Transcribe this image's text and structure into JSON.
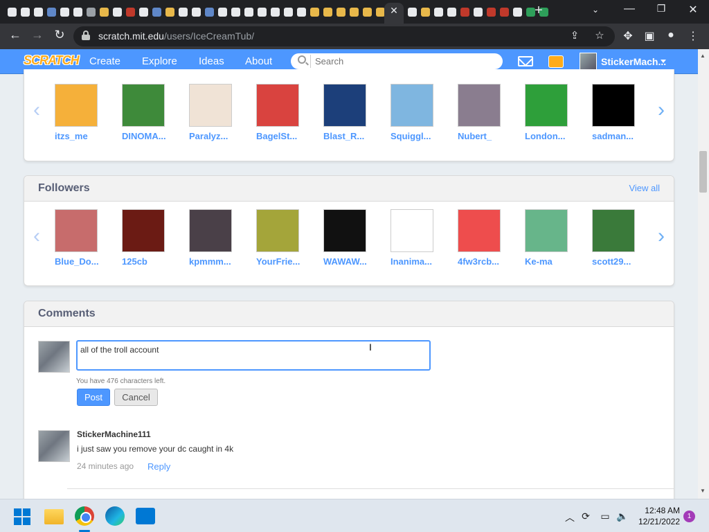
{
  "browser": {
    "url_host": "scratch.mit.edu",
    "url_path": "/users/IceCreamTub/",
    "tab_close": "✕",
    "new_tab": "+",
    "tab_icon_colors": [
      "#e8eaed",
      "#e8eaed",
      "#e8eaed",
      "#5f87c8",
      "#e8eaed",
      "#e8eaed",
      "#9aa0a6",
      "#e8b84a",
      "#e8eaed",
      "#c0392b",
      "#e8eaed",
      "#5f87c8",
      "#e8b84a",
      "#e8eaed",
      "#e8eaed",
      "#5f87c8",
      "#e8eaed",
      "#e8eaed",
      "#e8eaed",
      "#e8eaed",
      "#e8eaed",
      "#e8eaed",
      "#e8eaed",
      "#e8b84a",
      "#e8b84a",
      "#e8b84a",
      "#e8b84a",
      "#e8b84a",
      "#e8b84a",
      "#e8b84a"
    ],
    "tab_icon_colors_2": [
      "#e8eaed",
      "#e8b84a",
      "#e8eaed",
      "#e8eaed",
      "#c0392b",
      "#e8eaed",
      "#c0392b",
      "#c0392b",
      "#e8eaed",
      "#2e9f5a",
      "#2e9f5a"
    ]
  },
  "scratch_nav": {
    "logo": "SCRATCH",
    "links": [
      "Create",
      "Explore",
      "Ideas",
      "About"
    ],
    "search_placeholder": "Search",
    "username": "StickerMach...",
    "brand_color": "#4d97ff"
  },
  "following": {
    "users": [
      {
        "name": "itzs_me",
        "color": "#f5b03a"
      },
      {
        "name": "DINOMA...",
        "color": "#3e8a3a"
      },
      {
        "name": "Paralyz...",
        "color": "#f0e3d6"
      },
      {
        "name": "BagelSt...",
        "color": "#d9433f"
      },
      {
        "name": "Blast_R...",
        "color": "#1c3f7a"
      },
      {
        "name": "Squiggl...",
        "color": "#7fb6e0"
      },
      {
        "name": "Nubert_",
        "color": "#8a7d8f"
      },
      {
        "name": "London...",
        "color": "#2e9f3a"
      },
      {
        "name": "sadman...",
        "color": "#000000"
      }
    ]
  },
  "followers": {
    "title": "Followers",
    "view_all": "View all",
    "users": [
      {
        "name": "Blue_Do...",
        "color": "#c76c6c"
      },
      {
        "name": "125cb",
        "color": "#6b1b14"
      },
      {
        "name": "kpmmm...",
        "color": "#4a4048"
      },
      {
        "name": "YourFrie...",
        "color": "#a4a53a"
      },
      {
        "name": "WAWAW...",
        "color": "#111111"
      },
      {
        "name": "Inanima...",
        "color": "#ffffff"
      },
      {
        "name": "4fw3rcb...",
        "color": "#ee4d4d"
      },
      {
        "name": "Ke-ma",
        "color": "#67b58a"
      },
      {
        "name": "scott29...",
        "color": "#3a7a3a"
      }
    ]
  },
  "comments": {
    "title": "Comments",
    "draft": "all of the troll account",
    "chars_left": "You have 476 characters left.",
    "post_label": "Post",
    "cancel_label": "Cancel",
    "items": [
      {
        "author": "StickerMachine111",
        "text": "i just saw you remove your dc caught in 4k",
        "time": "24 minutes ago",
        "reply": "Reply"
      }
    ]
  },
  "taskbar": {
    "time": "12:48 AM",
    "date": "12/21/2022",
    "notifications": "1"
  }
}
